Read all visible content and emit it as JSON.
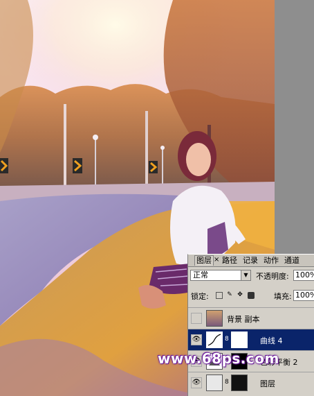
{
  "panel": {
    "tabs": [
      "图层",
      "路径",
      "记录",
      "动作",
      "通道"
    ],
    "close_glyph": "×",
    "blend_mode": "正常",
    "opacity_label": "不透明度:",
    "opacity_value": "100%",
    "lock_label": "锁定:",
    "fill_label": "填充:",
    "fill_value": "100%",
    "layers": [
      {
        "name": "背景 副本",
        "visible": false,
        "selected": false
      },
      {
        "name": "曲线 4",
        "visible": true,
        "selected": true
      },
      {
        "name": "色彩平衡 2",
        "visible": true,
        "selected": false
      },
      {
        "name": "图层",
        "visible": true,
        "selected": false
      }
    ]
  },
  "watermark": "www.68ps.com",
  "colors": {
    "selected_row": "#0a246a",
    "panel_bg": "#d4d0c8",
    "watermark_glow": "#6a1a9a"
  }
}
